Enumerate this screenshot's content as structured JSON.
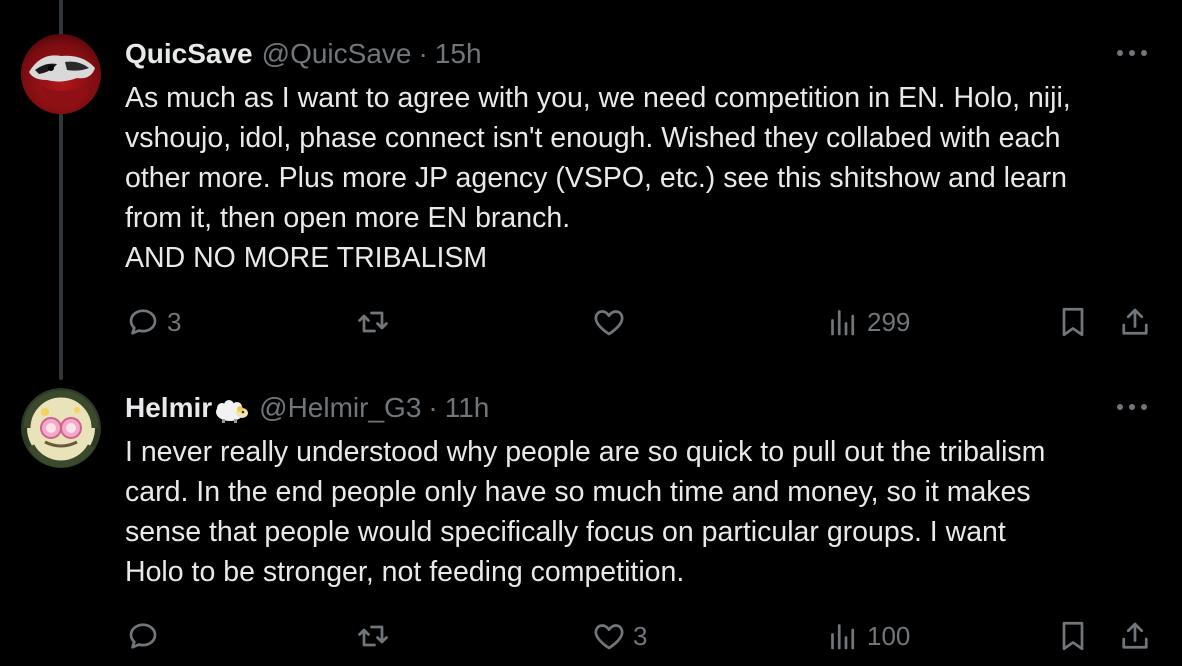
{
  "tweets": [
    {
      "display_name": "QuicSave",
      "handle": "@QuicSave",
      "separator": "·",
      "time": "15h",
      "more_label": "•••",
      "body_lines": [
        "As much as I want to agree with you, we need competition in EN. Holo, niji,",
        "vshoujo, idol, phase connect isn't enough. Wished they collabed with each",
        "other more. Plus more JP agency (VSPO, etc.) see this shitshow and learn",
        "from it, then open more EN branch.",
        "AND NO MORE TRIBALISM"
      ],
      "actions": {
        "replies": "3",
        "retweets": "",
        "likes": "",
        "views": "299"
      }
    },
    {
      "display_name": "Helmir",
      "handle": "@Helmir_G3",
      "separator": "·",
      "time": "11h",
      "more_label": "•••",
      "body_lines": [
        "I never really understood why people are so quick to pull out the tribalism",
        "card. In the end people only have so much time and money, so it makes",
        "sense that people would specifically focus on particular groups. I want",
        "Holo to be stronger, not feeding competition."
      ],
      "actions": {
        "replies": "",
        "retweets": "",
        "likes": "3",
        "views": "100"
      }
    }
  ],
  "icons": {
    "reply": "reply-icon",
    "retweet": "retweet-icon",
    "like": "heart-icon",
    "views": "views-icon",
    "bookmark": "bookmark-icon",
    "share": "share-icon",
    "badge": "sheep-icon"
  },
  "colors": {
    "background": "#000000",
    "text_primary": "#e7e9ea",
    "text_secondary": "#71767b",
    "thread_line": "#333639"
  }
}
